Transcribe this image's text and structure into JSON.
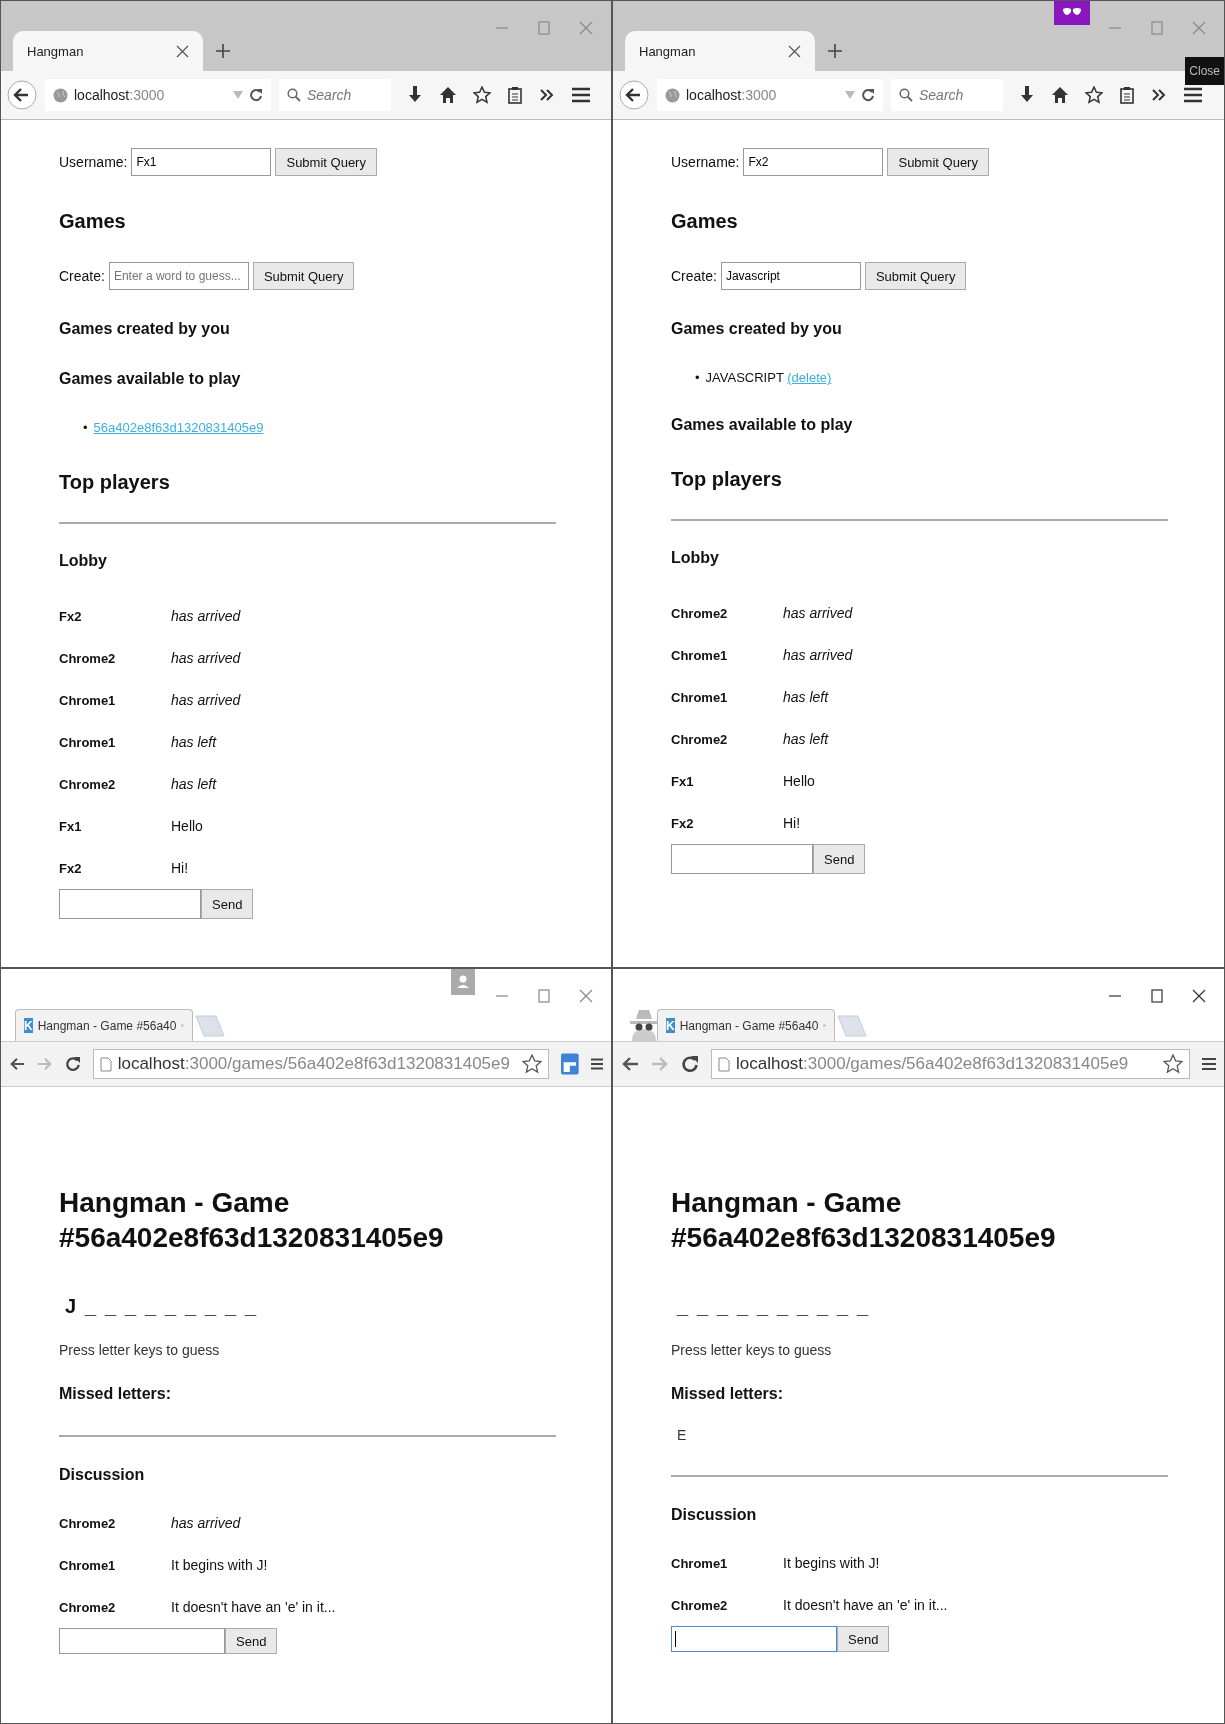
{
  "windows": [
    {
      "kind": "firefox",
      "private": false,
      "tab_title": "Hangman",
      "url": {
        "host": "localhost",
        "rest": ":3000"
      },
      "search_placeholder": "Search",
      "page": {
        "kind": "lobby",
        "username_label": "Username:",
        "username": "Fx1",
        "submit": "Submit Query",
        "games_heading": "Games",
        "create_label": "Create:",
        "create_placeholder": "Enter a word to guess...",
        "create_submit": "Submit Query",
        "created_heading": "Games created by you",
        "available_heading": "Games available to play",
        "available": [
          {
            "bullet": "•",
            "link": "56a402e8f63d1320831405e9"
          }
        ],
        "top_heading": "Top players",
        "lobby_heading": "Lobby",
        "messages": [
          {
            "name": "Fx2",
            "text": "has arrived",
            "kind": "event"
          },
          {
            "name": "Chrome2",
            "text": "has arrived",
            "kind": "event"
          },
          {
            "name": "Chrome1",
            "text": "has arrived",
            "kind": "event"
          },
          {
            "name": "Chrome1",
            "text": "has left",
            "kind": "event"
          },
          {
            "name": "Chrome2",
            "text": "has left",
            "kind": "event"
          },
          {
            "name": "Fx1",
            "text": "Hello",
            "kind": "message"
          },
          {
            "name": "Fx2",
            "text": "Hi!",
            "kind": "message"
          }
        ],
        "send": "Send"
      }
    },
    {
      "kind": "firefox",
      "private": true,
      "tooltip": "Close",
      "tab_title": "Hangman",
      "url": {
        "host": "localhost",
        "rest": ":3000"
      },
      "search_placeholder": "Search",
      "page": {
        "kind": "lobby",
        "username_label": "Username:",
        "username": "Fx2",
        "submit": "Submit Query",
        "games_heading": "Games",
        "create_label": "Create:",
        "create_value": "Javascript",
        "create_submit": "Submit Query",
        "created_heading": "Games created by you",
        "created": [
          {
            "bullet": "•",
            "word": "JAVASCRIPT",
            "action": "(delete)"
          }
        ],
        "available_heading": "Games available to play",
        "top_heading": "Top players",
        "lobby_heading": "Lobby",
        "messages": [
          {
            "name": "Chrome2",
            "text": "has arrived",
            "kind": "event"
          },
          {
            "name": "Chrome1",
            "text": "has arrived",
            "kind": "event"
          },
          {
            "name": "Chrome1",
            "text": "has left",
            "kind": "event"
          },
          {
            "name": "Chrome2",
            "text": "has left",
            "kind": "event"
          },
          {
            "name": "Fx1",
            "text": "Hello",
            "kind": "message"
          },
          {
            "name": "Fx2",
            "text": "Hi!",
            "kind": "message"
          }
        ],
        "send": "Send"
      }
    },
    {
      "kind": "chrome",
      "profile_button": true,
      "incognito": false,
      "extension": true,
      "favicon": "K",
      "tab_title": "Hangman - Game #56a40",
      "url": {
        "host": "localhost",
        "rest": ":3000/games/56a402e8f63d1320831405e9"
      },
      "page": {
        "kind": "game",
        "title": "Hangman - Game #56a402e8f63d1320831405e9",
        "letters": [
          "J",
          "_",
          "_",
          "_",
          "_",
          "_",
          "_",
          "_",
          "_",
          "_"
        ],
        "hint": "Press letter keys to guess",
        "missed_heading": "Missed letters:",
        "discussion_heading": "Discussion",
        "messages": [
          {
            "name": "Chrome2",
            "text": "has arrived",
            "kind": "event"
          },
          {
            "name": "Chrome1",
            "text": "It begins with J!",
            "kind": "message"
          },
          {
            "name": "Chrome2",
            "text": "It doesn't have an 'e' in it...",
            "kind": "message"
          }
        ],
        "send": "Send",
        "input_focused": false
      }
    },
    {
      "kind": "chrome",
      "profile_button": false,
      "incognito": true,
      "extension": false,
      "favicon": "K",
      "tab_title": "Hangman - Game #56a40",
      "url": {
        "host": "localhost",
        "rest": ":3000/games/56a402e8f63d1320831405e9"
      },
      "page": {
        "kind": "game",
        "title": "Hangman - Game #56a402e8f63d1320831405e9",
        "letters": [
          "_",
          "_",
          "_",
          "_",
          "_",
          "_",
          "_",
          "_",
          "_",
          "_"
        ],
        "hint": "Press letter keys to guess",
        "missed_heading": "Missed letters:",
        "missed": [
          "E"
        ],
        "discussion_heading": "Discussion",
        "messages": [
          {
            "name": "Chrome1",
            "text": "It begins with J!",
            "kind": "message"
          },
          {
            "name": "Chrome2",
            "text": "It doesn't have an 'e' in it...",
            "kind": "message"
          }
        ],
        "send": "Send",
        "input_focused": true
      }
    }
  ]
}
